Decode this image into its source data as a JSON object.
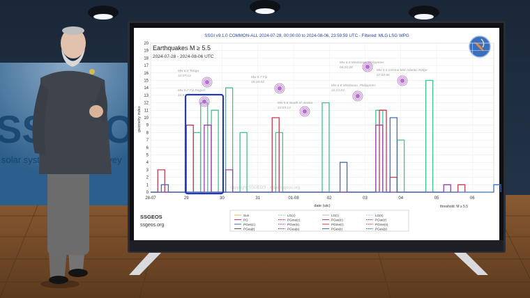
{
  "chart_data": {
    "type": "line",
    "title": "SSGI v9.1.0 COMMON-ALL 2024-07-28, 00:00:00 to 2024-08-06, 23:59:59 UTC - Filtered: MLG LSG WPG",
    "subtitle": "Earthquakes M ≥ 5.5",
    "date_range": "2024-07-28 - 2024-08-06 UTC",
    "ylabel": "geometry index",
    "xlabel": "date (utc)",
    "ylim": [
      0,
      20
    ],
    "yticks": [
      "0",
      "1",
      "2",
      "3",
      "4",
      "5",
      "6",
      "7",
      "8",
      "9",
      "10",
      "11",
      "12",
      "13",
      "14",
      "15",
      "16",
      "17",
      "18",
      "19",
      "20"
    ],
    "xticks": [
      "28-07",
      "29",
      "30",
      "31",
      "01-08",
      "02",
      "03",
      "04",
      "05",
      "06"
    ],
    "threshold_note": "threshold: M ≥ 5.5",
    "watermark": "copyright SSGEOS - www.ssgeos.org",
    "annotations": [
      {
        "name": "Mw 6.0 Tonga",
        "time": "13:07:13"
      },
      {
        "name": "Mw 5.7 Fiji Region",
        "time": "12:57:"
      },
      {
        "name": "Mw 5.7 Fiji",
        "time": "15:18:03"
      },
      {
        "name": "Mw 5.6 South of Alaska",
        "time": "10:03:13"
      },
      {
        "name": "Mw 6.8 Mindanao, Philippines",
        "time": "22:23:03"
      },
      {
        "name": "Mw 6.3 Mindanao, Philippines",
        "time": "04:20:28"
      },
      {
        "name": "Mw 5.5 Central Mid-Atlantic Ridge",
        "time": "07:03:56"
      }
    ],
    "legend": [
      "Sun",
      "LG(c)",
      "LG(r)",
      "LG(s)",
      "PG",
      "PGme(c)",
      "PGve(c)",
      "PGve(r)",
      "PGes(c)",
      "PGve(s)",
      "PGme(r)",
      "PGme(s)",
      "PGea(r)",
      "PGea(s)",
      "PGes(r)",
      "PGes(s)"
    ],
    "series": [
      {
        "name": "LG(c)",
        "color": "#3cc48c",
        "values": [
          [
            1.2,
            8
          ],
          [
            1.4,
            12
          ],
          [
            1.7,
            11
          ],
          [
            2.1,
            14
          ],
          [
            2.5,
            8
          ],
          [
            3.5,
            8
          ],
          [
            4.8,
            12
          ],
          [
            6.3,
            11
          ],
          [
            6.9,
            7
          ],
          [
            7.7,
            15
          ]
        ]
      },
      {
        "name": "PG",
        "color": "#c8394a",
        "values": [
          [
            0.2,
            3
          ],
          [
            1.0,
            9
          ],
          [
            3.4,
            10
          ],
          [
            6.4,
            11
          ],
          [
            6.7,
            2
          ],
          [
            8.6,
            1
          ]
        ]
      },
      {
        "name": "PGve(c)",
        "color": "#9e3ba8",
        "values": [
          [
            1.5,
            9
          ],
          [
            2.1,
            3
          ],
          [
            6.3,
            9
          ],
          [
            8.2,
            1
          ]
        ]
      },
      {
        "name": "PGes(c)",
        "color": "#3b6fc4",
        "values": [
          [
            0.3,
            1
          ],
          [
            1.7,
            0
          ],
          [
            5.3,
            4
          ],
          [
            6.7,
            10
          ],
          [
            9.6,
            1
          ]
        ]
      }
    ]
  },
  "footer": {
    "brand": "SSGEOS",
    "site": "ssgeos.org"
  },
  "backdrop": {
    "logo_letters": "SSGEOS",
    "tagline": "solar system geometry survey"
  }
}
